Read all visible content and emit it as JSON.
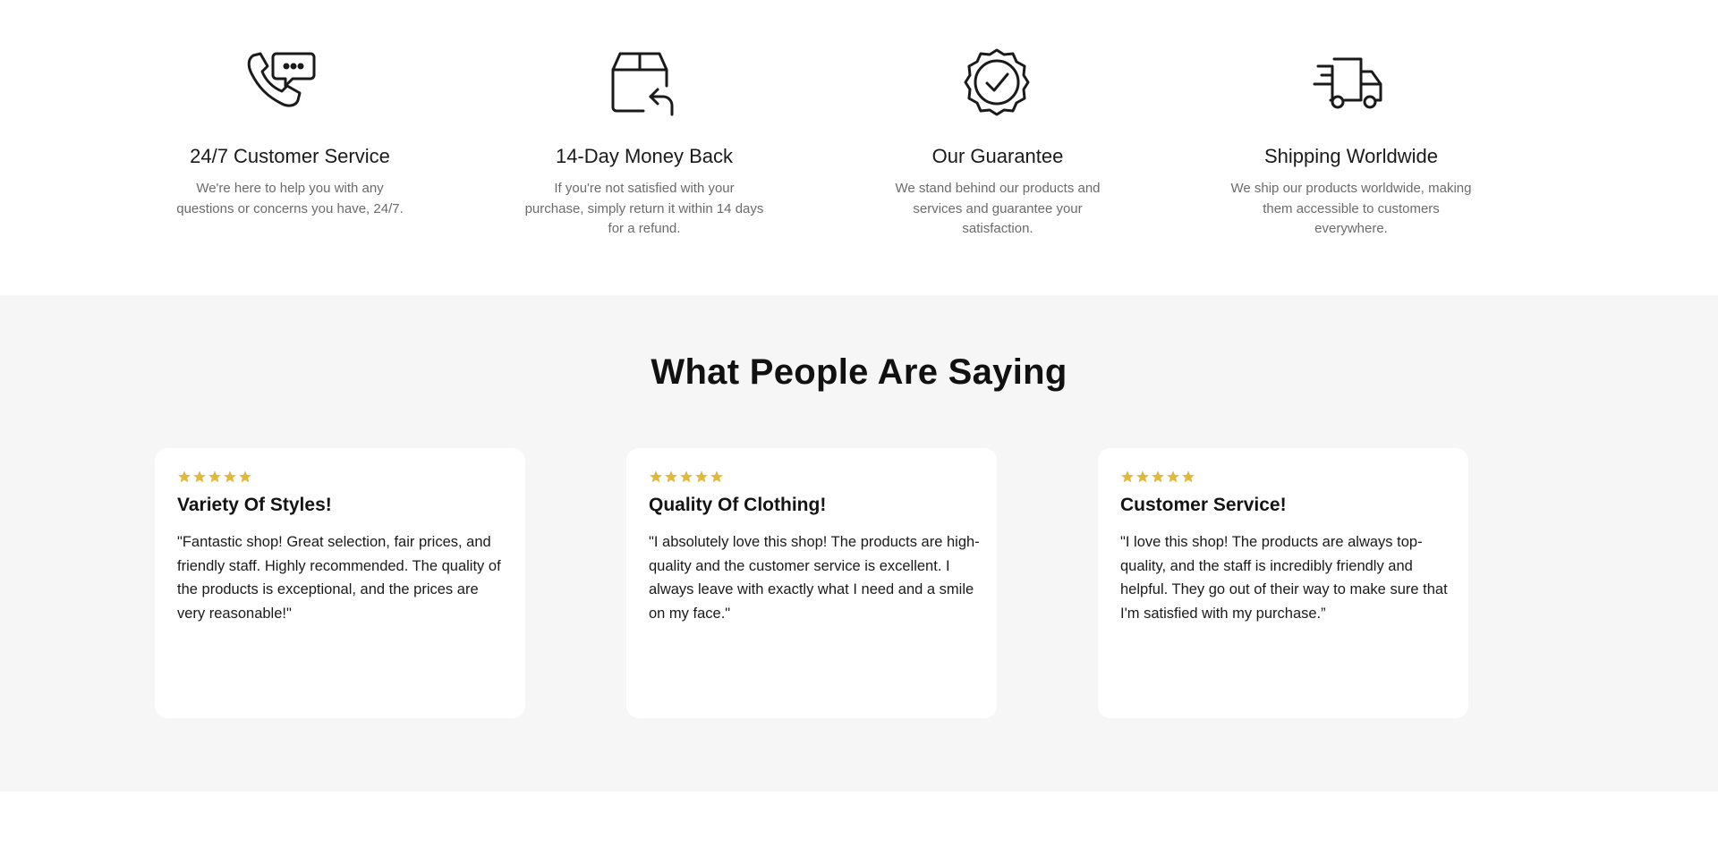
{
  "features": [
    {
      "icon": "phone-chat-icon",
      "title": "24/7 Customer Service",
      "desc": "We're here to help you with any questions or concerns you have, 24/7."
    },
    {
      "icon": "box-return-icon",
      "title": "14-Day Money Back",
      "desc": "If you're not satisfied with your purchase, simply return it within 14 days for a refund."
    },
    {
      "icon": "badge-check-icon",
      "title": "Our Guarantee",
      "desc": "We stand behind our products and services and guarantee your satisfaction."
    },
    {
      "icon": "delivery-truck-icon",
      "title": "Shipping Worldwide",
      "desc": "We ship our products worldwide, making them accessible to customers everywhere."
    }
  ],
  "reviews": {
    "heading": "What People Are Saying",
    "star_color": "#e0b93a",
    "items": [
      {
        "rating": 5,
        "title": "Variety Of Styles!",
        "text": "\"Fantastic shop! Great selection, fair prices, and friendly staff. Highly recommended. The quality of the products is exceptional, and the prices are very reasonable!\""
      },
      {
        "rating": 5,
        "title": "Quality Of Clothing!",
        "text": "\"I absolutely love this shop! The products are high-quality and the customer service is excellent. I always leave with exactly what I need and a smile on my face.\""
      },
      {
        "rating": 5,
        "title": "Customer Service!",
        "text": "\"I love this shop! The products are always top-quality, and the staff is incredibly friendly and helpful. They go out of their way to make sure that I'm satisfied with my purchase.”"
      }
    ]
  }
}
